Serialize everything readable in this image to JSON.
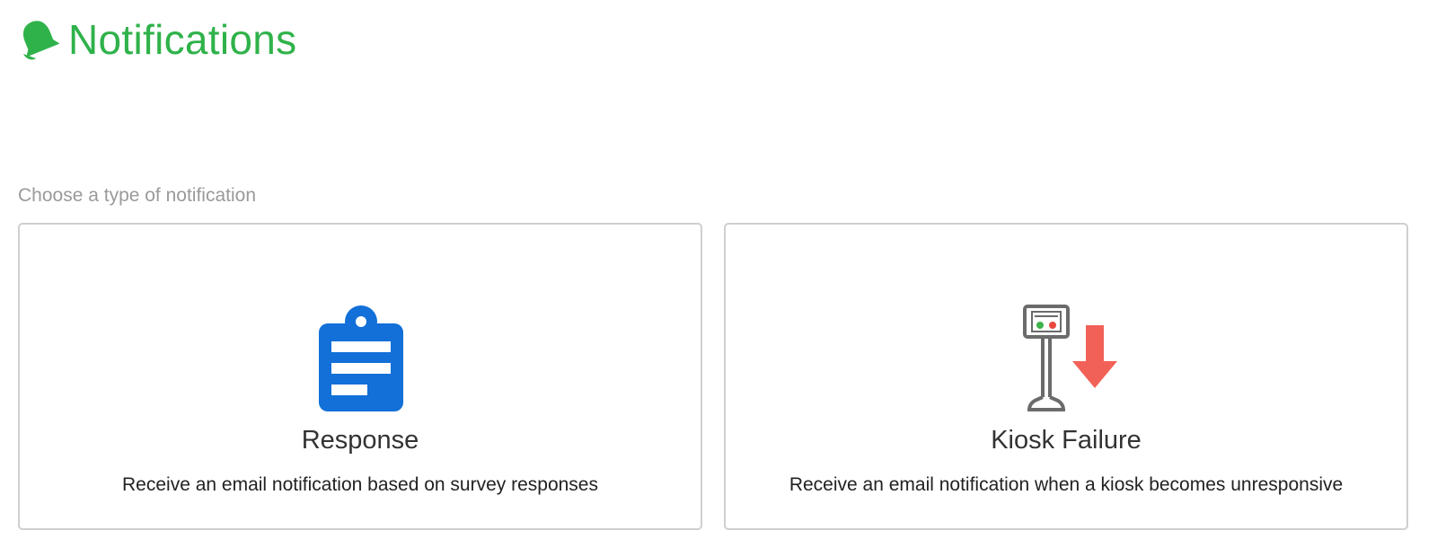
{
  "header": {
    "title": "Notifications",
    "icon": "bell-icon",
    "accent_color": "#2fb24a"
  },
  "section": {
    "label": "Choose a type of notification"
  },
  "cards": [
    {
      "id": "response",
      "icon": "clipboard-icon",
      "icon_color": "#1270d8",
      "title": "Response",
      "description": "Receive an email notification based on survey responses"
    },
    {
      "id": "kiosk-failure",
      "icon": "kiosk-down-icon",
      "icon_colors": {
        "outline": "#6b6b6b",
        "arrow": "#f26157",
        "dot_green": "#3cb44b",
        "dot_red": "#e8473d"
      },
      "title": "Kiosk Failure",
      "description": "Receive an email notification when a kiosk becomes unresponsive"
    }
  ]
}
